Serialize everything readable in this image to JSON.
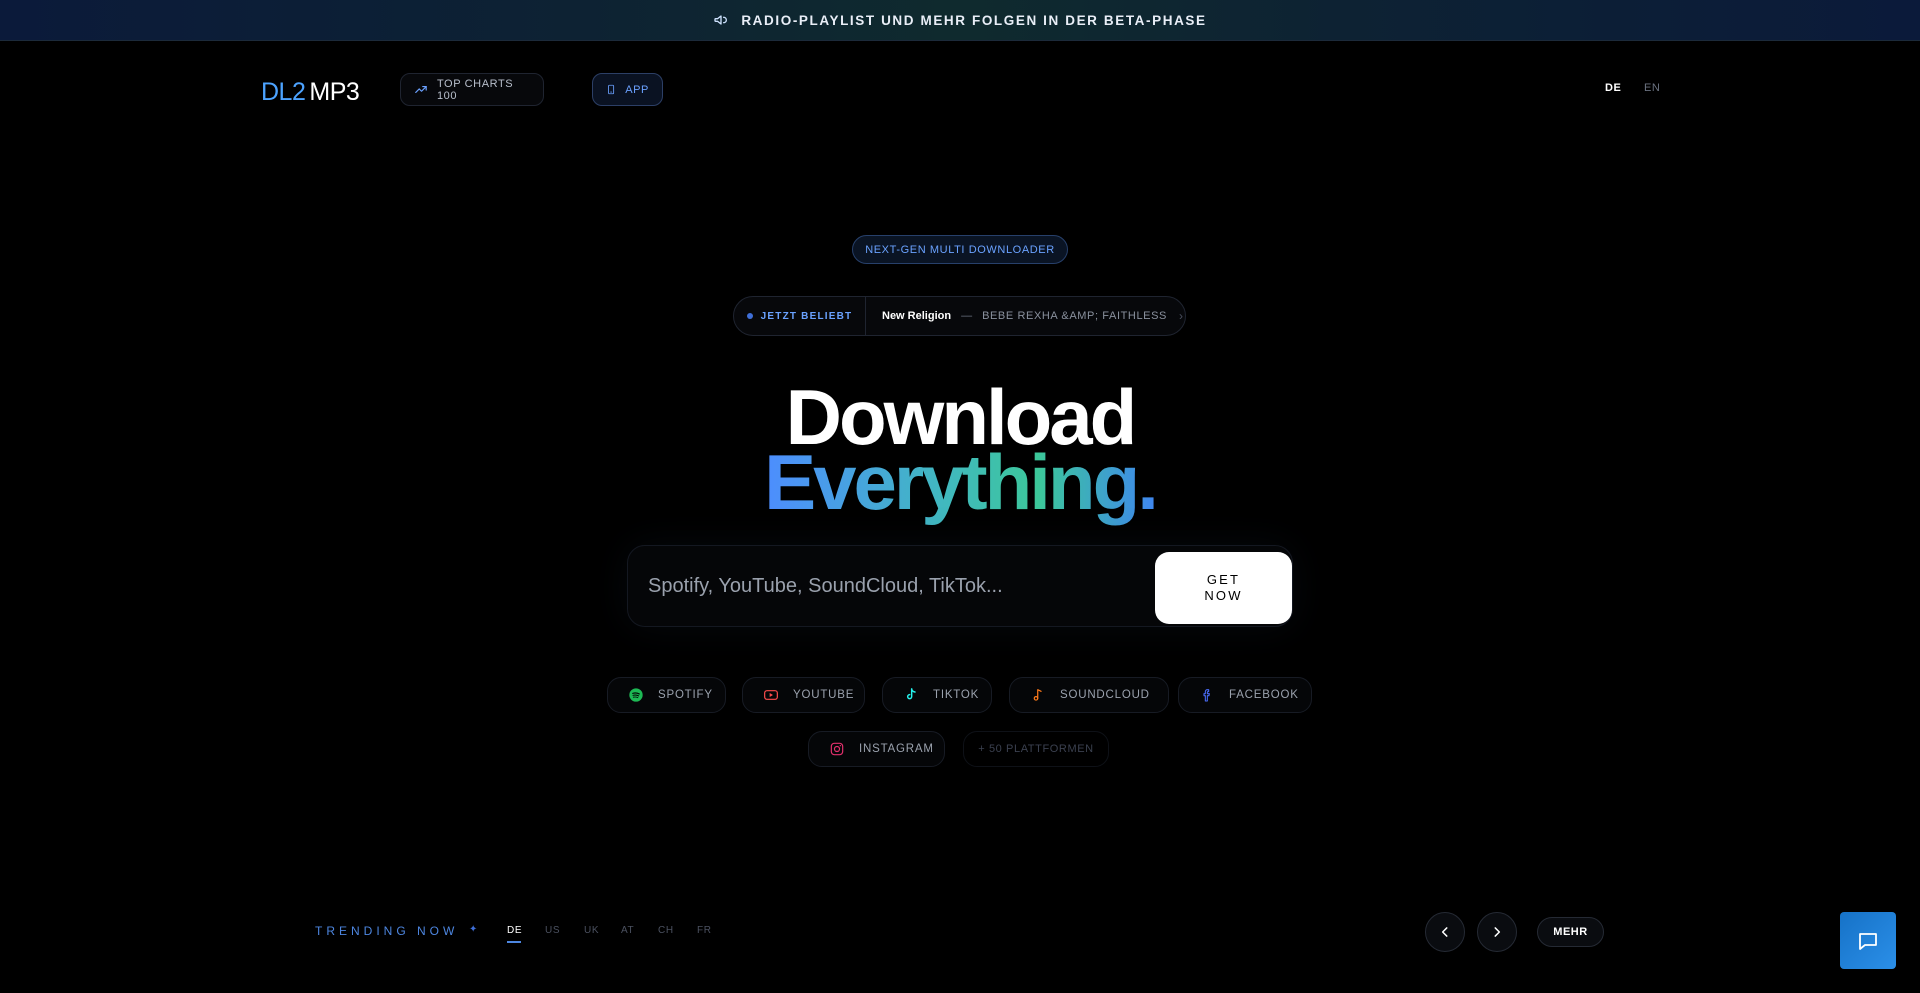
{
  "banner": {
    "text": "RADIO-PLAYLIST UND MEHR FOLGEN IN DER BETA-PHASE",
    "icon": "megaphone-icon"
  },
  "logo": {
    "part1": "DL2",
    "part2": "MP3"
  },
  "nav": {
    "charts_label": "TOP CHARTS 100",
    "app_label": "APP"
  },
  "languages": {
    "de": "DE",
    "en": "EN",
    "selected": "DE"
  },
  "hero": {
    "badge": "NEXT-GEN MULTI DOWNLOADER",
    "trending_badge": "JETZT BELIEBT",
    "trending_title": "New Religion",
    "trending_sep": "—",
    "trending_artist": "BEBE REXHA &AMP; FAITHLESS",
    "trending_chevron": "›",
    "headline_line1": "Download",
    "headline_line2": "Everything."
  },
  "search": {
    "placeholder": "Spotify, YouTube, SoundCloud, TikTok...",
    "value": "",
    "button_label": "GET NOW"
  },
  "platforms": [
    {
      "label": "SPOTIFY",
      "icon": "spotify-icon",
      "color": "#1db954"
    },
    {
      "label": "YOUTUBE",
      "icon": "youtube-icon",
      "color": "#ff4d4d"
    },
    {
      "label": "TIKTOK",
      "icon": "tiktok-icon",
      "color": "#25f4ee"
    },
    {
      "label": "SOUNDCLOUD",
      "icon": "soundcloud-icon",
      "color": "#ff7a1a"
    },
    {
      "label": "FACEBOOK",
      "icon": "facebook-icon",
      "color": "#4a6cf7"
    },
    {
      "label": "INSTAGRAM",
      "icon": "instagram-icon",
      "color": "#e1306c"
    }
  ],
  "more_platforms": "+ 50 PLATTFORMEN",
  "trending": {
    "label": "TRENDING NOW",
    "star": "✦",
    "countries": [
      "DE",
      "US",
      "UK",
      "AT",
      "CH",
      "FR"
    ],
    "selected": "DE",
    "more_label": "MEHR"
  },
  "colors": {
    "accent": "#4d86e0",
    "background": "#000000",
    "chat_button": "#1e80d6"
  }
}
